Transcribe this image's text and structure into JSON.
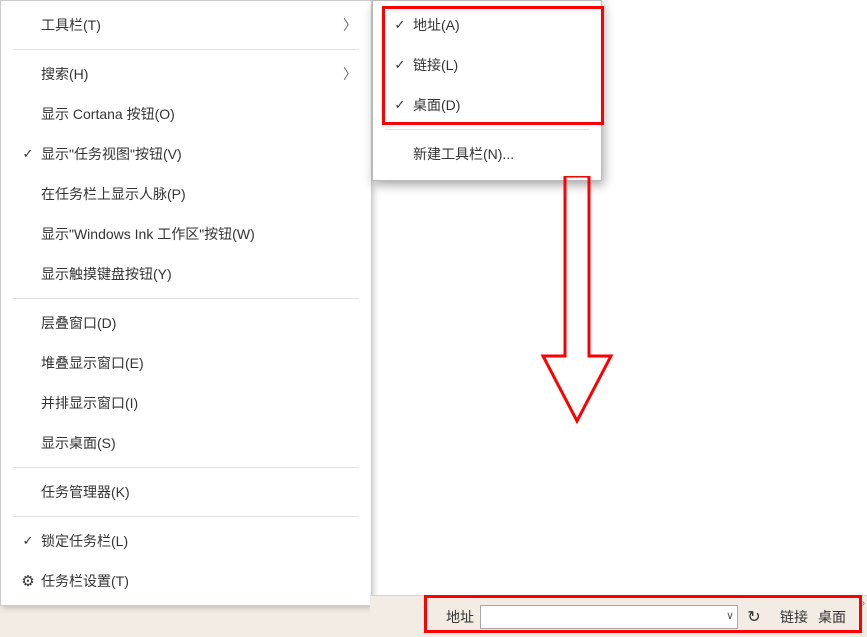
{
  "main_menu": {
    "toolbar": {
      "label": "工具栏(T)",
      "has_submenu": true
    },
    "search": {
      "label": "搜索(H)",
      "has_submenu": true
    },
    "cortana": {
      "label": "显示 Cortana 按钮(O)"
    },
    "taskview": {
      "label": "显示\"任务视图\"按钮(V)",
      "checked": true
    },
    "people": {
      "label": "在任务栏上显示人脉(P)"
    },
    "ink": {
      "label": "显示\"Windows Ink 工作区\"按钮(W)"
    },
    "touchkb": {
      "label": "显示触摸键盘按钮(Y)"
    },
    "cascade": {
      "label": "层叠窗口(D)"
    },
    "stacked": {
      "label": "堆叠显示窗口(E)"
    },
    "sidebyside": {
      "label": "并排显示窗口(I)"
    },
    "showdesktop": {
      "label": "显示桌面(S)"
    },
    "taskmgr": {
      "label": "任务管理器(K)"
    },
    "lock": {
      "label": "锁定任务栏(L)",
      "checked": true
    },
    "settings": {
      "label": "任务栏设置(T)",
      "icon": "gear"
    }
  },
  "submenu": {
    "address": {
      "label": "地址(A)",
      "checked": true
    },
    "links": {
      "label": "链接(L)",
      "checked": true
    },
    "desktop": {
      "label": "桌面(D)",
      "checked": true
    },
    "newtoolbar": {
      "label": "新建工具栏(N)..."
    }
  },
  "taskbar": {
    "address_label": "地址",
    "address_value": "",
    "links_label": "链接",
    "desktop_label": "桌面"
  },
  "annotation_colors": {
    "red": "#ff0000"
  }
}
